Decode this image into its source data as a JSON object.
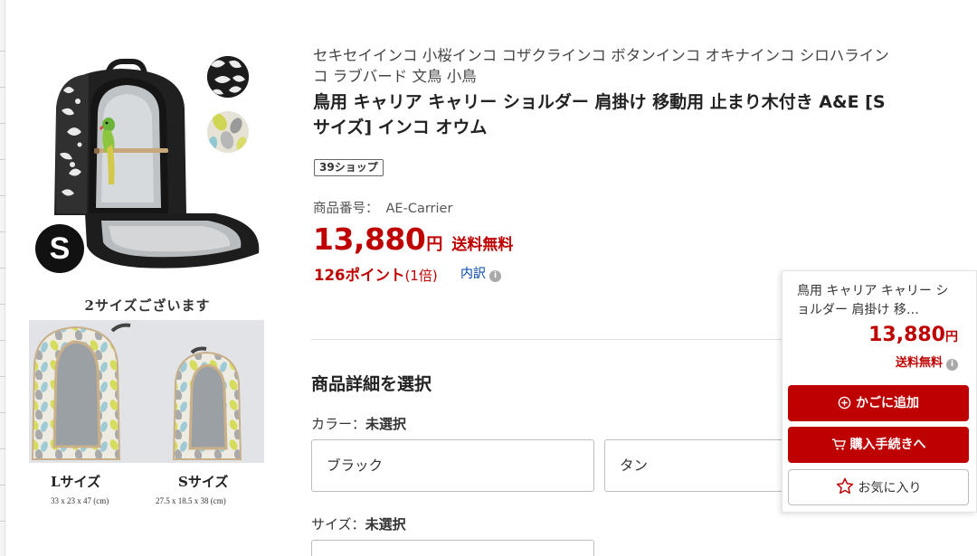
{
  "product": {
    "category_text": "セキセイインコ 小桜インコ コザクラインコ ボタンインコ オキナインコ シロハラインコ ラブバード 文鳥 小鳥",
    "title": "鳥用 キャリア キャリー ショルダー 肩掛け 移動用 止まり木付き A&E [Sサイズ] インコ オウム",
    "shop_badge": "39ショップ",
    "sku_label": "商品番号：",
    "sku_value": "AE-Carrier",
    "price": "13,880",
    "yen": "円",
    "shipping": "送料無料",
    "points": "126ポイント",
    "points_multiplier": "(1倍)",
    "breakdown_link": "内訳"
  },
  "images": {
    "size_badge": "S",
    "size_caption": "2サイズございます",
    "large_label": "Lサイズ",
    "large_dims": "33 x 23 x 47 (cm)",
    "small_label": "Sサイズ",
    "small_dims": "27.5 x 18.5 x 38 (cm)"
  },
  "options": {
    "section_title": "商品詳細を選択",
    "color_label": "カラー：",
    "color_status": "未選択",
    "colors": [
      "ブラック",
      "タン"
    ],
    "size_label": "サイズ：",
    "size_status": "未選択"
  },
  "cart_panel": {
    "title": "鳥用 キャリア キャリー ショルダー 肩掛け 移…",
    "price": "13,880",
    "yen": "円",
    "shipping": "送料無料",
    "add_to_cart": "かごに追加",
    "checkout": "購入手続きへ",
    "favorite": "お気に入り"
  },
  "colors": {
    "accent_red": "#bf0000",
    "link_blue": "#0044a6"
  }
}
